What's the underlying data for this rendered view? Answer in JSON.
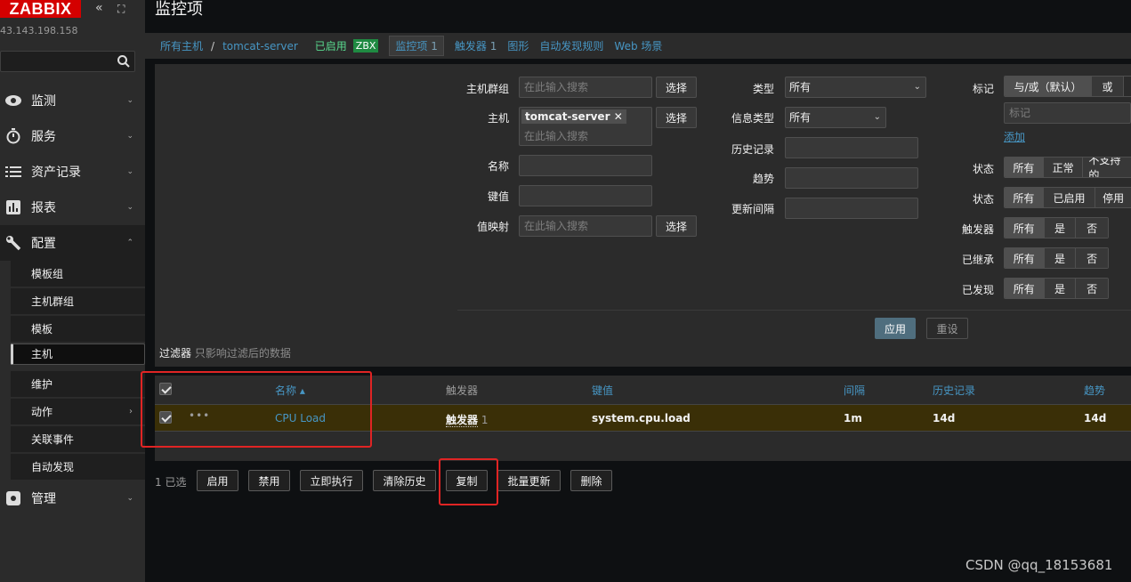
{
  "sidebar": {
    "logo": "ZABBIX",
    "ip": "43.143.198.158",
    "menu": [
      {
        "label": "监测",
        "icon": "eye-icon"
      },
      {
        "label": "服务",
        "icon": "stopwatch-icon"
      },
      {
        "label": "资产记录",
        "icon": "list-icon"
      },
      {
        "label": "报表",
        "icon": "bar-chart-icon"
      },
      {
        "label": "配置",
        "icon": "wrench-icon"
      },
      {
        "label": "管理",
        "icon": "gear-icon"
      }
    ],
    "submenu": [
      "模板组",
      "主机群组",
      "模板",
      "主机",
      "维护",
      "动作",
      "关联事件",
      "自动发现"
    ]
  },
  "header": {
    "title": "监控项"
  },
  "breadcrumb": {
    "all_hosts": "所有主机",
    "sep": "/",
    "host": "tomcat-server",
    "enabled": "已启用",
    "zbx": "ZBX",
    "items": "监控项",
    "items_count": "1",
    "triggers": "触发器",
    "triggers_count": "1",
    "graphs": "图形",
    "discovery": "自动发现规则",
    "web": "Web 场景"
  },
  "filter": {
    "host_group_label": "主机群组",
    "host_group_placeholder": "在此输入搜索",
    "select": "选择",
    "host_label": "主机",
    "host_tag": "tomcat-server",
    "host_placeholder": "在此输入搜索",
    "name_label": "名称",
    "key_label": "键值",
    "valuemap_label": "值映射",
    "valuemap_placeholder": "在此输入搜索",
    "type_label": "类型",
    "type_value": "所有",
    "info_type_label": "信息类型",
    "info_type_value": "所有",
    "history_label": "历史记录",
    "trends_label": "趋势",
    "interval_label": "更新间隔",
    "tags_label": "标记",
    "tags_and_or": "与/或（默认）",
    "tags_or": "或",
    "tag_placeholder": "标记",
    "add": "添加",
    "state_label": "状态",
    "state_opts": [
      "所有",
      "正常",
      "不支持的"
    ],
    "status_label": "状态",
    "status_opts": [
      "所有",
      "已启用",
      "停用"
    ],
    "triggers_label": "触发器",
    "inherited_label": "已继承",
    "discovered_label": "已发现",
    "yesno_opts": [
      "所有",
      "是",
      "否"
    ],
    "apply": "应用",
    "reset": "重设",
    "tab_label": "过滤器",
    "tab_hint": "只影响过滤后的数据"
  },
  "table": {
    "headers": {
      "name": "名称 ▴",
      "triggers": "触发器",
      "key": "键值",
      "interval": "间隔",
      "history": "历史记录",
      "trends": "趋势"
    },
    "rows": [
      {
        "name": "CPU Load",
        "triggers": "触发器",
        "triggers_count": "1",
        "key": "system.cpu.load",
        "interval": "1m",
        "history": "14d",
        "trends": "14d"
      }
    ]
  },
  "actions": {
    "selected": "1 已选",
    "buttons": [
      "启用",
      "禁用",
      "立即执行",
      "清除历史",
      "复制",
      "批量更新",
      "删除"
    ]
  },
  "watermark": "CSDN @qq_18153681"
}
